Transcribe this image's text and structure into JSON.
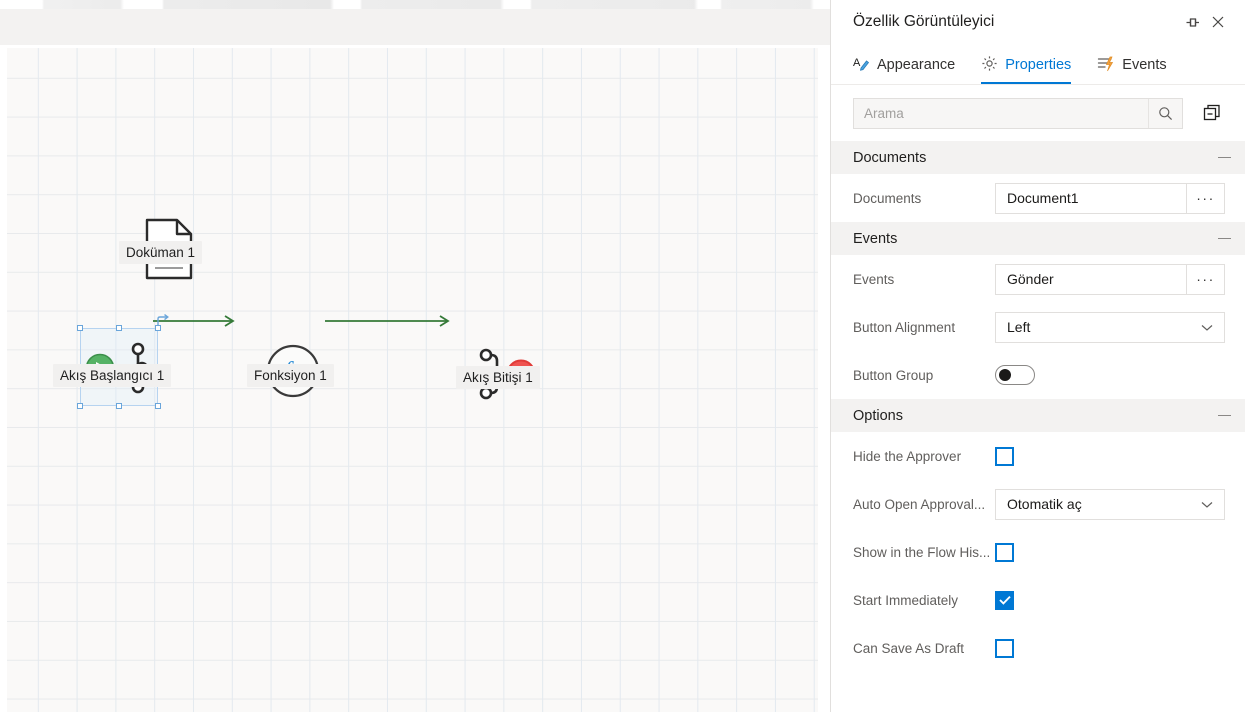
{
  "designer": {
    "name": "flow-designer-canvas",
    "nodes": [
      {
        "id": "document",
        "label": "Doküman 1",
        "icon": "document-icon"
      },
      {
        "id": "start",
        "label": "Akış Başlangıcı 1",
        "icon": "flow-start-icon",
        "selected": true
      },
      {
        "id": "function",
        "label": "Fonksiyon 1",
        "icon": "function-fx-icon"
      },
      {
        "id": "end",
        "label": "Akış Bitişi 1",
        "icon": "flow-end-icon"
      }
    ],
    "connector_color": "#357a38",
    "selection_color": "#6aa5da"
  },
  "panel": {
    "title": "Özellik Görüntüleyici",
    "pin_icon": "pin-icon",
    "close_icon": "close-icon",
    "tabs": [
      {
        "label": "Appearance",
        "icon": "appearance-pencil-icon",
        "active": false
      },
      {
        "label": "Properties",
        "icon": "gear-icon",
        "active": true
      },
      {
        "label": "Events",
        "icon": "lightning-events-icon",
        "active": false
      }
    ],
    "search": {
      "placeholder": "Arama",
      "value": "",
      "icon": "search-icon",
      "collapse_all_icon": "collapse-all-icon"
    },
    "accent_color": "#0078d4",
    "sections": [
      {
        "title": "Documents",
        "collapse_icon": "minus-icon",
        "rows": [
          {
            "label": "Documents",
            "type": "text-browse",
            "value": "Document1",
            "button_label": "···",
            "name": "documents-field"
          }
        ]
      },
      {
        "title": "Events",
        "collapse_icon": "minus-icon",
        "rows": [
          {
            "label": "Events",
            "type": "text-browse",
            "value": "Gönder",
            "button_label": "···",
            "name": "events-field"
          },
          {
            "label": "Button Alignment",
            "type": "combo",
            "value": "Left",
            "name": "button-alignment-select"
          },
          {
            "label": "Button Group",
            "type": "switch",
            "value": false,
            "name": "button-group-toggle"
          }
        ]
      },
      {
        "title": "Options",
        "collapse_icon": "minus-icon",
        "rows": [
          {
            "label": "Hide the Approver",
            "type": "checkbox",
            "value": false,
            "name": "hide-the-approver-checkbox"
          },
          {
            "label": "Auto Open Approval...",
            "type": "combo",
            "value": "Otomatik aç",
            "name": "auto-open-approval-select"
          },
          {
            "label": "Show in the Flow His...",
            "type": "checkbox",
            "value": false,
            "name": "show-in-flow-history-checkbox"
          },
          {
            "label": "Start Immediately",
            "type": "checkbox",
            "value": true,
            "name": "start-immediately-checkbox"
          },
          {
            "label": "Can Save As Draft",
            "type": "checkbox",
            "value": false,
            "name": "can-save-as-draft-checkbox"
          }
        ]
      }
    ]
  }
}
